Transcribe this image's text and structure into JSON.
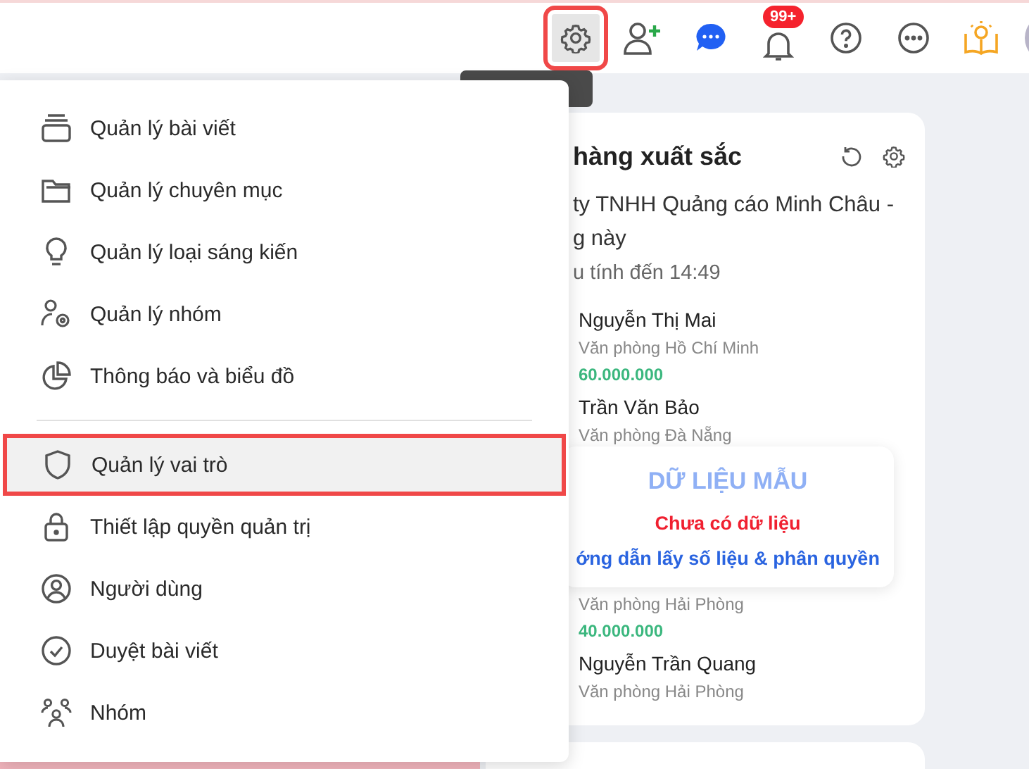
{
  "top_bar": {
    "notification_badge": "99+",
    "settings_selected": true
  },
  "menu": {
    "groups": [
      [
        {
          "label": "Quản lý bài viết",
          "selected": false
        },
        {
          "label": "Quản lý chuyên mục",
          "selected": false
        },
        {
          "label": "Quản lý loại sáng kiến",
          "selected": false
        },
        {
          "label": "Quản lý nhóm",
          "selected": false
        },
        {
          "label": "Thông báo và biểu đồ",
          "selected": false
        }
      ],
      [
        {
          "label": "Quản lý vai trò",
          "selected": true
        },
        {
          "label": "Thiết lập quyền quản trị",
          "selected": false
        },
        {
          "label": "Người dùng",
          "selected": false
        },
        {
          "label": "Duyệt bài viết",
          "selected": false
        },
        {
          "label": "Nhóm",
          "selected": false
        }
      ]
    ]
  },
  "card": {
    "title": "hàng xuất sắc",
    "description_lines": [
      "ty TNHH Quảng cáo Minh Châu -",
      "g này"
    ],
    "updated": "u tính đến 14:49",
    "rows_above": [
      {
        "name": "Nguyễn Thị Mai",
        "office": "Văn phòng Hồ Chí Minh",
        "amount": "60.000.000"
      },
      {
        "name": "Trần Văn Bảo",
        "office": "Văn phòng Đà Nẵng"
      }
    ],
    "sample_overlay": {
      "title": "DỮ LIỆU MẪU",
      "message": "Chưa có dữ liệu",
      "link": "ớng dẫn lấy số liệu & phân quyền"
    },
    "rows_below": [
      {
        "office": "Văn phòng Hải Phòng",
        "amount": "40.000.000"
      },
      {
        "name": "Nguyễn Trần Quang",
        "office": "Văn phòng Hải Phòng"
      }
    ]
  }
}
